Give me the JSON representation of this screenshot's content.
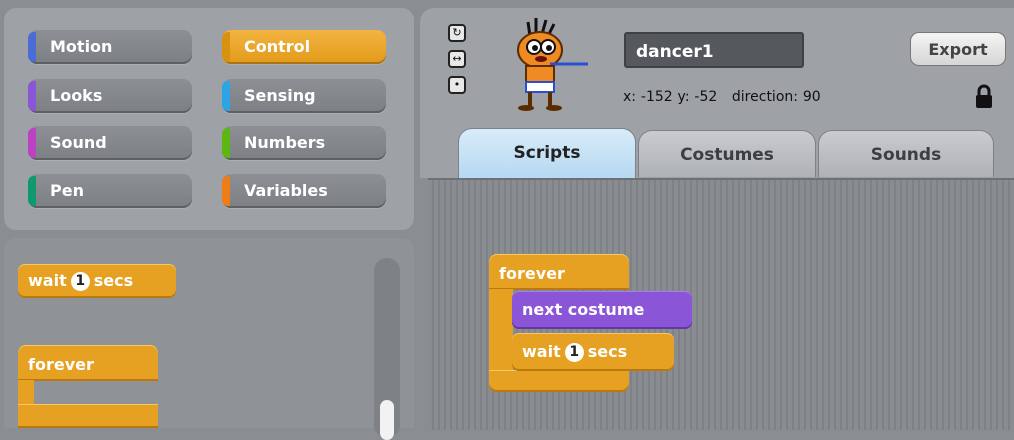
{
  "categories": [
    {
      "label": "Motion",
      "color": "#4a6cd4"
    },
    {
      "label": "Control",
      "color": "#e1a91a",
      "active": true
    },
    {
      "label": "Looks",
      "color": "#8a55d7"
    },
    {
      "label": "Sensing",
      "color": "#2ca5e2"
    },
    {
      "label": "Sound",
      "color": "#bb42c3"
    },
    {
      "label": "Numbers",
      "color": "#5cb712"
    },
    {
      "label": "Pen",
      "color": "#0e9a6c"
    },
    {
      "label": "Variables",
      "color": "#ee7d16"
    }
  ],
  "palette": {
    "wait_prefix": "wait",
    "wait_value": "1",
    "wait_suffix": "secs",
    "forever_label": "forever"
  },
  "sprite": {
    "name": "dancer1",
    "export_label": "Export",
    "x_label": "x:",
    "x_value": "-152",
    "y_label": "y:",
    "y_value": "-52",
    "direction_label": "direction:",
    "direction_value": "90"
  },
  "tabs": [
    {
      "label": "Scripts",
      "active": true
    },
    {
      "label": "Costumes"
    },
    {
      "label": "Sounds"
    }
  ],
  "script": {
    "forever_label": "forever",
    "next_costume_label": "next costume",
    "wait_prefix": "wait",
    "wait_value": "1",
    "wait_suffix": "secs"
  },
  "colors": {
    "control": "#e6a122",
    "looks": "#8a55d7",
    "active_tab": "#b5d8f2"
  }
}
